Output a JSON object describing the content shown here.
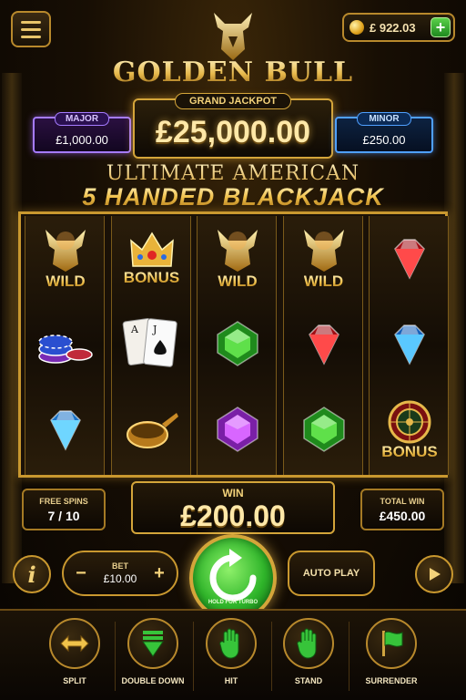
{
  "header": {
    "balance": "£ 922.03",
    "add_label": "+",
    "brand": "GOLDEN BULL"
  },
  "jackpots": {
    "grand": {
      "label": "GRAND JACKPOT",
      "value": "£25,000.00"
    },
    "major": {
      "label": "MAJOR",
      "value": "£1,000.00"
    },
    "minor": {
      "label": "MINOR",
      "value": "£250.00"
    }
  },
  "game_title": {
    "line1": "ULTIMATE AMERICAN",
    "line2": "5 HANDED BLACKJACK"
  },
  "reels": [
    [
      {
        "symbol": "wild-bull",
        "label": "WILD"
      },
      {
        "symbol": "poker-chips",
        "label": ""
      },
      {
        "symbol": "blue-diamond",
        "label": ""
      }
    ],
    [
      {
        "symbol": "crown-bonus",
        "label": "BONUS"
      },
      {
        "symbol": "playing-cards",
        "label": ""
      },
      {
        "symbol": "golden-bowl",
        "label": ""
      }
    ],
    [
      {
        "symbol": "wild-bull",
        "label": "WILD"
      },
      {
        "symbol": "green-gem",
        "label": ""
      },
      {
        "symbol": "purple-gem",
        "label": ""
      }
    ],
    [
      {
        "symbol": "wild-bull",
        "label": "WILD"
      },
      {
        "symbol": "red-gem",
        "label": ""
      },
      {
        "symbol": "green-gem",
        "label": ""
      }
    ],
    [
      {
        "symbol": "red-gem",
        "label": ""
      },
      {
        "symbol": "blue-gem",
        "label": ""
      },
      {
        "symbol": "roulette-bonus",
        "label": "BONUS"
      }
    ]
  ],
  "stats": {
    "free_spins_label": "FREE SPINS",
    "free_spins_value": "7 / 10",
    "win_label": "WIN",
    "win_value": "£200.00",
    "total_win_label": "TOTAL WIN",
    "total_win_value": "£450.00"
  },
  "controls": {
    "info_label": "i",
    "bet_label": "BET",
    "bet_value": "£10.00",
    "bet_minus": "−",
    "bet_plus": "+",
    "spin_hint": "HOLD FOR TURBO",
    "autoplay_label": "AUTO PLAY"
  },
  "actions": [
    {
      "label": "SPLIT",
      "icon": "split-arrows-icon"
    },
    {
      "label": "DOUBLE DOWN",
      "icon": "double-down-icon"
    },
    {
      "label": "HIT",
      "icon": "hand-hit-icon"
    },
    {
      "label": "STAND",
      "icon": "hand-stand-icon"
    },
    {
      "label": "SURRENDER",
      "icon": "flag-icon"
    }
  ],
  "colors": {
    "gold": "#d4a53a",
    "major_purple": "#a57bff",
    "minor_blue": "#4fa0ff",
    "spin_green": "#2fb52a"
  }
}
